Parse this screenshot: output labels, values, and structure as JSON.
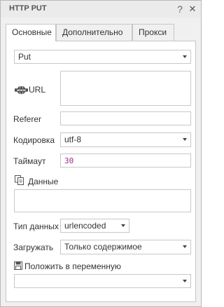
{
  "window": {
    "title": "HTTP PUT",
    "help_glyph": "?",
    "close_glyph": "✕"
  },
  "tabs": [
    {
      "label": "Основные",
      "active": true
    },
    {
      "label": "Дополнительно",
      "active": false
    },
    {
      "label": "Прокси",
      "active": false
    }
  ],
  "form": {
    "method": {
      "value": "Put"
    },
    "url": {
      "label": "URL",
      "value": "",
      "icon": "www-globe-icon"
    },
    "referer": {
      "label": "Referer",
      "value": ""
    },
    "encoding": {
      "label": "Кодировка",
      "value": "utf-8"
    },
    "timeout": {
      "label": "Таймаут",
      "value": "30"
    },
    "data": {
      "label": "Данные",
      "value": "",
      "icon": "copy-data-icon"
    },
    "data_type": {
      "label": "Тип данных",
      "value": "urlencoded"
    },
    "load": {
      "label": "Загружать",
      "value": "Только содержимое"
    },
    "save_to_var": {
      "label": "Положить в переменную",
      "value": "",
      "icon": "save-floppy-icon"
    }
  },
  "colors": {
    "window_bg": "#f0f0f0",
    "panel_bg": "#ffffff",
    "border": "#c8c8c8",
    "timeout_text": "#9a2a8a"
  }
}
